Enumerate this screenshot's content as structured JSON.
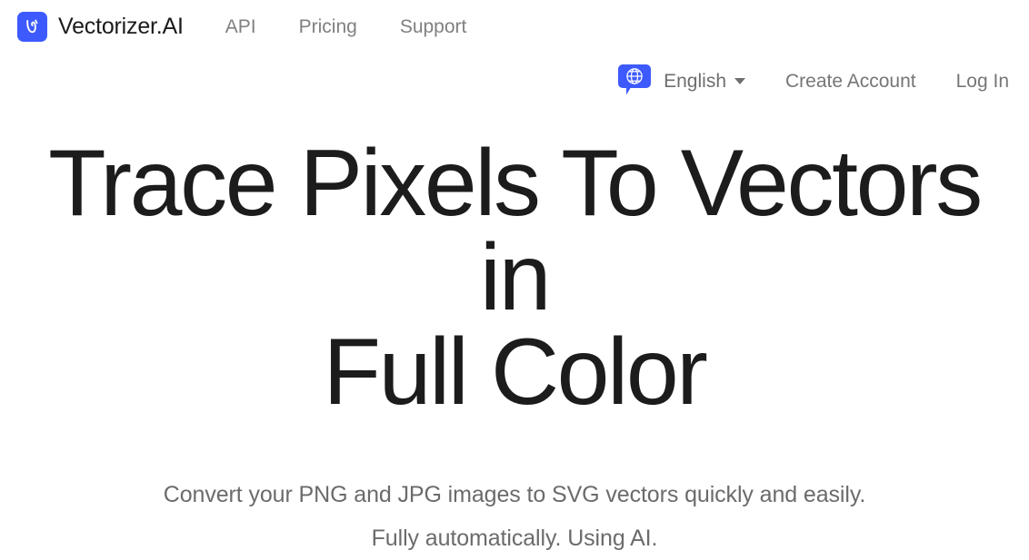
{
  "brand": {
    "name": "Vectorizer.AI",
    "logo_icon": "vectorizer-upsilon-logo",
    "logo_color": "#3d5afe"
  },
  "header": {
    "primary_nav": [
      {
        "label": "API",
        "name": "nav-link-api"
      },
      {
        "label": "Pricing",
        "name": "nav-link-pricing"
      },
      {
        "label": "Support",
        "name": "nav-link-support"
      }
    ],
    "language": {
      "icon": "globe-speech-bubble-icon",
      "label": "English",
      "caret_icon": "chevron-down-icon"
    },
    "account": {
      "create_account_label": "Create Account",
      "log_in_label": "Log In"
    },
    "colors": {
      "nav_link": "#808080",
      "account_link": "#767676",
      "brand_text": "#1b1b1b"
    }
  },
  "hero": {
    "title_line_1": "Trace Pixels To Vectors in",
    "title_line_2": "Full Color",
    "subtitle_line_1": "Convert your PNG and JPG images to SVG vectors quickly and easily.",
    "subtitle_line_2": "Fully automatically. Using AI.",
    "colors": {
      "title": "#1c1c1c",
      "subtitle": "#6b6b6b"
    }
  }
}
